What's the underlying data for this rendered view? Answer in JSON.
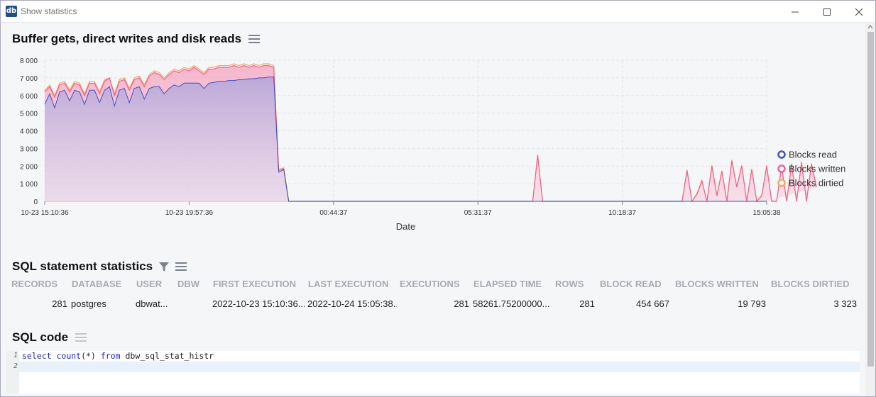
{
  "window": {
    "app_icon_text": "db",
    "title": "Show statistics",
    "minimize_icon": "minimize-icon",
    "maximize_icon": "maximize-icon",
    "close_icon": "close-icon"
  },
  "chart_section": {
    "title": "Buffer gets, direct writes and disk reads",
    "menu_icon": "menu-icon"
  },
  "chart_data": {
    "type": "area",
    "xlabel": "Date",
    "x_tick_labels": [
      "10-23 15:10:36",
      "10-23 19:57:36",
      "00:44:37",
      "05:31:37",
      "10:18:37",
      "15:05:38"
    ],
    "ylim": [
      0,
      8000
    ],
    "y_tick_labels": [
      "0",
      "1 000",
      "2 000",
      "3 000",
      "4 000",
      "5 000",
      "6 000",
      "7 000",
      "8 000"
    ],
    "y_ticks": [
      0,
      1000,
      2000,
      3000,
      4000,
      5000,
      6000,
      7000,
      8000
    ],
    "grid": true,
    "legend_placement": "right",
    "x_count": 146,
    "series": [
      {
        "name": "Blocks read",
        "color": "#3d52c4",
        "values": [
          5500,
          6100,
          5300,
          6200,
          6300,
          5700,
          6300,
          6200,
          5500,
          6300,
          6300,
          5600,
          6300,
          6500,
          5400,
          6300,
          6400,
          5600,
          6400,
          6500,
          5800,
          6400,
          6500,
          6500,
          6100,
          6400,
          6600,
          6500,
          6700,
          6700,
          6700,
          6700,
          6400,
          6700,
          6750,
          6800,
          6800,
          6850,
          6850,
          6900,
          6900,
          6950,
          6950,
          7000,
          7000,
          7050,
          7050,
          1650,
          1800,
          0,
          0,
          0,
          0,
          0,
          0,
          0,
          0,
          0,
          0,
          0,
          0,
          0,
          0,
          0,
          0,
          0,
          0,
          0,
          0,
          0,
          0,
          0,
          0,
          0,
          0,
          0,
          0,
          0,
          0,
          0,
          0,
          0,
          0,
          0,
          0,
          0,
          0,
          0,
          0,
          0,
          0,
          0,
          0,
          0,
          0,
          0,
          0,
          0,
          0,
          0,
          0,
          0,
          0,
          0,
          0,
          0,
          0,
          0,
          0,
          0,
          0,
          0,
          0,
          0,
          0,
          0,
          0,
          0,
          0,
          0,
          0,
          0,
          0,
          0,
          0,
          0,
          0,
          0,
          0,
          0,
          0,
          0,
          0,
          0,
          0,
          0,
          0,
          0,
          0,
          0,
          0,
          0,
          0,
          0,
          0,
          0
        ]
      },
      {
        "name": "Blocks written",
        "color": "#f06292",
        "values": [
          6200,
          6500,
          5900,
          6600,
          6700,
          6200,
          6700,
          6600,
          6000,
          6700,
          6700,
          6100,
          6800,
          7000,
          6000,
          6800,
          6900,
          6300,
          6900,
          7000,
          6500,
          7100,
          7300,
          7200,
          6900,
          7200,
          7400,
          7300,
          7500,
          7400,
          7600,
          7400,
          7200,
          7500,
          7500,
          7600,
          7600,
          7600,
          7700,
          7600,
          7700,
          7600,
          7700,
          7600,
          7700,
          7700,
          7600,
          1750,
          1850,
          0,
          0,
          0,
          0,
          0,
          0,
          0,
          0,
          0,
          0,
          0,
          0,
          0,
          0,
          0,
          0,
          0,
          0,
          0,
          0,
          0,
          0,
          0,
          0,
          0,
          0,
          0,
          0,
          0,
          0,
          0,
          0,
          0,
          0,
          0,
          0,
          0,
          0,
          0,
          0,
          0,
          0,
          0,
          0,
          0,
          0,
          0,
          0,
          0,
          0,
          2600,
          0,
          0,
          0,
          0,
          0,
          0,
          0,
          0,
          0,
          0,
          0,
          0,
          0,
          0,
          0,
          0,
          0,
          0,
          0,
          0,
          0,
          0,
          0,
          0,
          0,
          0,
          0,
          0,
          0,
          1750,
          0,
          400,
          1150,
          0,
          2000,
          300,
          1700,
          0,
          2300,
          800,
          2000,
          0,
          1800,
          0,
          300,
          2000,
          0,
          0,
          2000,
          0,
          2100,
          0,
          2200,
          0,
          2100,
          800
        ]
      },
      {
        "name": "Blocks dirtied",
        "color": "#f5a962",
        "values": [
          6300,
          6600,
          6000,
          6700,
          6800,
          6300,
          6800,
          6700,
          6100,
          6800,
          6800,
          6200,
          6900,
          7000,
          6100,
          6900,
          7000,
          6400,
          7000,
          7100,
          6600,
          7200,
          7400,
          7300,
          7000,
          7300,
          7500,
          7400,
          7600,
          7500,
          7700,
          7500,
          7300,
          7600,
          7600,
          7700,
          7700,
          7700,
          7800,
          7700,
          7800,
          7700,
          7800,
          7700,
          7800,
          7800,
          7700,
          1800,
          1900,
          0,
          0,
          0,
          0,
          0,
          0,
          0,
          0,
          0,
          0,
          0,
          0,
          0,
          0,
          0,
          0,
          0,
          0,
          0,
          0,
          0,
          0,
          0,
          0,
          0,
          0,
          0,
          0,
          0,
          0,
          0,
          0,
          0,
          0,
          0,
          0,
          0,
          0,
          0,
          0,
          0,
          0,
          0,
          0,
          0,
          0,
          0,
          0,
          0,
          0,
          2650,
          0,
          0,
          0,
          0,
          0,
          0,
          0,
          0,
          0,
          0,
          0,
          0,
          0,
          0,
          0,
          0,
          0,
          0,
          0,
          0,
          0,
          0,
          0,
          0,
          0,
          0,
          0,
          0,
          0,
          1800,
          0,
          450,
          1200,
          0,
          2050,
          350,
          1750,
          0,
          2350,
          850,
          2050,
          0,
          1850,
          0,
          350,
          2050,
          0,
          0,
          2050,
          0,
          2150,
          0,
          2250,
          0,
          2150,
          850
        ]
      }
    ]
  },
  "sql_stats": {
    "title": "SQL statement statistics",
    "filter_icon": "filter-icon",
    "menu_icon": "menu-icon",
    "columns": [
      "RECORDS",
      "DATABASE",
      "USER",
      "DBW",
      "FIRST EXECUTION",
      "LAST EXECUTION",
      "EXECUTIONS",
      "ELAPSED TIME",
      "ROWS",
      "BLOCK READ",
      "BLOCKS WRITTEN",
      "BLOCKS DIRTIED"
    ],
    "rows": [
      [
        "281",
        "postgres",
        "dbwat...",
        "",
        "2022-10-23 15:10:36....",
        "2022-10-24 15:05:38....",
        "281",
        "58261.75200000...",
        "281",
        "454 667",
        "19 793",
        "3 323"
      ]
    ]
  },
  "sql_code": {
    "title": "SQL code",
    "menu_icon": "menu-icon",
    "lines": [
      "1",
      "2"
    ],
    "code_kw1": "select",
    "code_fn": "count",
    "code_args": "(*)",
    "code_kw2": "from",
    "code_table": "dbw_sql_stat_histr"
  }
}
